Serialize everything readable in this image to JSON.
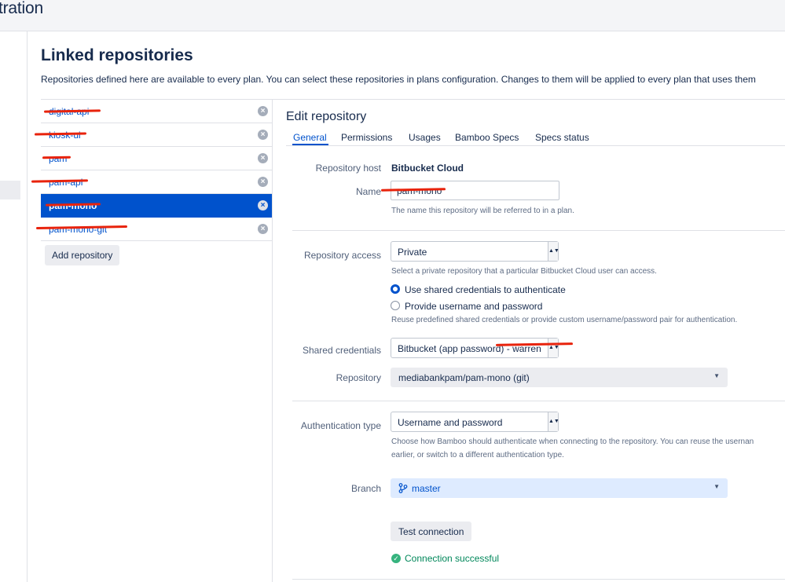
{
  "header": {
    "title": "tration"
  },
  "page": {
    "title": "Linked repositories",
    "description": "Repositories defined here are available to every plan. You can select these repositories in plans configuration. Changes to them will be applied to every plan that uses them"
  },
  "repo_list": {
    "items": [
      {
        "label": "digital-api",
        "active": false
      },
      {
        "label": "kiosk-ui",
        "active": false
      },
      {
        "label": "pam",
        "active": false
      },
      {
        "label": "pam-api",
        "active": false
      },
      {
        "label": "pam-mono",
        "active": true
      },
      {
        "label": "pam-mono-git",
        "active": false
      }
    ],
    "remove_glyph": "×",
    "add_label": "Add repository"
  },
  "edit": {
    "title": "Edit repository",
    "tabs": [
      "General",
      "Permissions",
      "Usages",
      "Bamboo Specs",
      "Specs status"
    ],
    "active_tab": "General",
    "repo_host_label": "Repository host",
    "repo_host_value": "Bitbucket Cloud",
    "name_label": "Name",
    "name_value": "pam-mono",
    "name_hint": "The name this repository will be referred to in a plan.",
    "access_label": "Repository access",
    "access_value": "Private",
    "access_hint": "Select a private repository that a particular Bitbucket Cloud user can access.",
    "radio_shared": "Use shared credentials to authenticate",
    "radio_custom": "Provide username and password",
    "radio_selected": "shared",
    "creds_hint": "Reuse predefined shared credentials or provide custom username/password pair for authentication.",
    "shared_creds_label": "Shared credentials",
    "shared_creds_value": "Bitbucket (app password) - warren",
    "repository_label": "Repository",
    "repository_value": "mediabankpam/pam-mono (git)",
    "auth_type_label": "Authentication type",
    "auth_type_value": "Username and password",
    "auth_hint_1": "Choose how Bamboo should authenticate when connecting to the repository. You can reuse the usernan",
    "auth_hint_2": "earlier, or switch to a different authentication type.",
    "branch_label": "Branch",
    "branch_value": "master",
    "test_button": "Test connection",
    "status_text": "Connection successful",
    "select_arrow": "▲▼",
    "caret": "▼",
    "check_glyph": "✓"
  },
  "colors": {
    "accent": "#0052cc",
    "redaction": "#e8230c",
    "success": "#00875a"
  }
}
